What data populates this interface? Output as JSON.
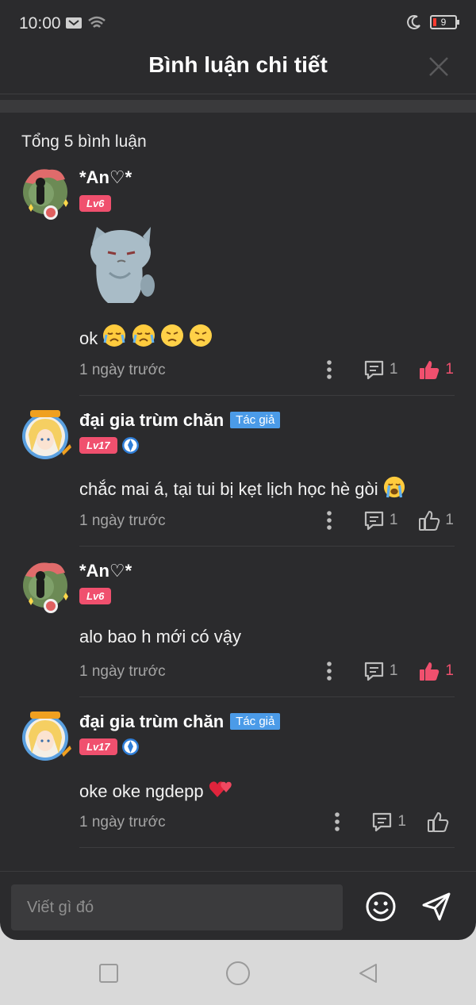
{
  "status_bar": {
    "time": "10:00",
    "battery": "9"
  },
  "header": {
    "title": "Bình luận chi tiết"
  },
  "total_label": "Tổng 5 bình luận",
  "comments": [
    {
      "username": "*An♡*",
      "level": "Lv6",
      "is_author": false,
      "author_label": "",
      "text": "ok",
      "emojis": [
        "crying-face",
        "crying-face",
        "frowning-face",
        "frowning-face"
      ],
      "has_sticker": true,
      "time": "1 ngày trước",
      "reply_count": "1",
      "like_count": "1",
      "liked": true
    },
    {
      "username": "đại gia trùm chăn",
      "level": "Lv17",
      "is_author": true,
      "author_label": "Tác giả",
      "text": "chắc mai á, tại tui bị kẹt lịch học hè gòi",
      "emojis": [
        "loudly-crying-face"
      ],
      "time": "1 ngày trước",
      "reply_count": "1",
      "like_count": "1",
      "liked": false
    },
    {
      "username": "*An♡*",
      "level": "Lv6",
      "is_author": false,
      "author_label": "",
      "text": "alo bao h mới có vậy",
      "time": "1 ngày trước",
      "reply_count": "1",
      "like_count": "1",
      "liked": true
    },
    {
      "username": "đại gia trùm chăn",
      "level": "Lv17",
      "is_author": true,
      "author_label": "Tác giả",
      "text": "oke oke ngdepp",
      "emojis": [
        "hearts"
      ],
      "time": "1 ngày trước",
      "reply_count": "1",
      "like_count": "",
      "liked": false
    }
  ],
  "input": {
    "placeholder": "Viết gì đó"
  },
  "colors": {
    "background": "#2b2b2d",
    "accent_pink": "#f0506e",
    "author_badge": "#4b9be8",
    "muted_text": "#a5a5a5"
  },
  "icons": [
    "close-icon",
    "more-icon",
    "reply-icon",
    "like-icon",
    "emoji-icon",
    "send-icon",
    "verify-icon"
  ]
}
